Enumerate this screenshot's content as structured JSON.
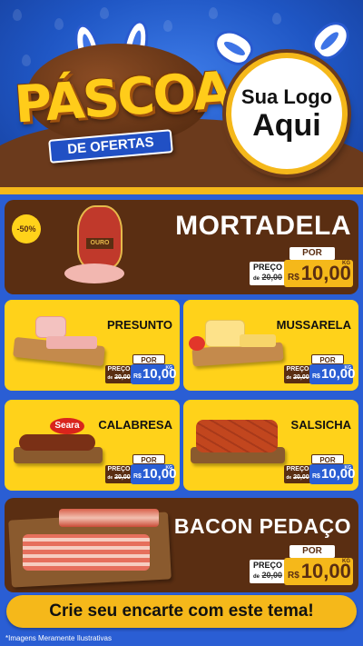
{
  "header": {
    "title": "PÁSCOA",
    "subtitle": "DE OFERTAS",
    "logo_line1": "Sua Logo",
    "logo_line2": "Aqui"
  },
  "colors": {
    "brand_blue": "#2a5ed4",
    "brand_yellow": "#ffd21a",
    "chocolate": "#5a2e12",
    "gold": "#f5b81a"
  },
  "featured": [
    {
      "name": "MORTADELA",
      "badge": "-50%",
      "brand": "OURO",
      "por_label": "POR",
      "preco_label": "PREÇO",
      "old_prefix": "de",
      "old_price": "20,00",
      "currency": "R$",
      "price": "10,00",
      "unit": "KG",
      "icon": "mortadella-icon"
    },
    {
      "name": "BACON PEDAÇO",
      "por_label": "POR",
      "preco_label": "PREÇO",
      "old_prefix": "de",
      "old_price": "20,00",
      "currency": "R$",
      "price": "10,00",
      "unit": "KG",
      "icon": "bacon-icon"
    }
  ],
  "products": [
    {
      "name": "PRESUNTO",
      "por_label": "POR",
      "preco_label": "PREÇO",
      "old_prefix": "de",
      "old_price": "20,00",
      "currency": "R$",
      "price": "10,00",
      "unit": "KG",
      "icon": "ham-icon"
    },
    {
      "name": "MUSSARELA",
      "por_label": "POR",
      "preco_label": "PREÇO",
      "old_prefix": "de",
      "old_price": "20,00",
      "currency": "R$",
      "price": "10,00",
      "unit": "KG",
      "icon": "cheese-icon"
    },
    {
      "name": "CALABRESA",
      "brand": "Seara",
      "por_label": "POR",
      "preco_label": "PREÇO",
      "old_prefix": "de",
      "old_price": "20,00",
      "currency": "R$",
      "price": "10,00",
      "unit": "KG",
      "icon": "sausage-icon"
    },
    {
      "name": "SALSICHA",
      "por_label": "POR",
      "preco_label": "PREÇO",
      "old_prefix": "de",
      "old_price": "20,00",
      "currency": "R$",
      "price": "10,00",
      "unit": "KG",
      "icon": "hotdog-icon"
    }
  ],
  "cta": "Crie seu encarte com este tema!",
  "disclaimer": "*Imagens Meramente Ilustrativas"
}
